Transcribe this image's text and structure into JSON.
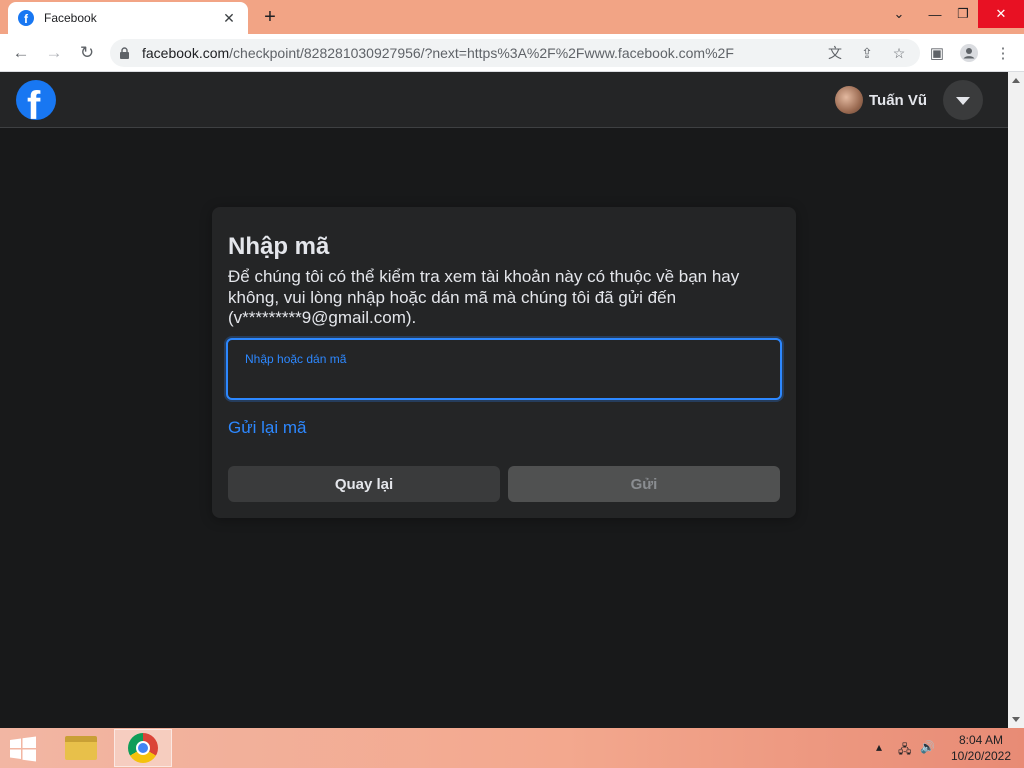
{
  "browser": {
    "tab_title": "Facebook",
    "tab_favicon": "f",
    "url_host": "facebook.com",
    "url_path": "/checkpoint/828281030927956/?next=https%3A%2F%2Fwww.facebook.com%2F"
  },
  "header": {
    "logo_letter": "f",
    "user_name": "Tuấn Vũ"
  },
  "dialog": {
    "title": "Nhập mã",
    "description": "Để chúng tôi có thể kiểm tra xem tài khoản này có thuộc về bạn hay không, vui lòng nhập hoặc dán mã mà chúng tôi đã gửi đến (v*********9@gmail.com).",
    "code_field_label": "Nhập hoặc dán mã",
    "code_value": "",
    "resend_link": "Gửi lại mã",
    "back_button": "Quay lại",
    "send_button": "Gửi"
  },
  "taskbar": {
    "time": "8:04 AM",
    "date": "10/20/2022"
  },
  "colors": {
    "facebook_blue": "#1877f2",
    "link_blue": "#2d88ff",
    "page_bg": "#18191a",
    "card_bg": "#242526"
  }
}
